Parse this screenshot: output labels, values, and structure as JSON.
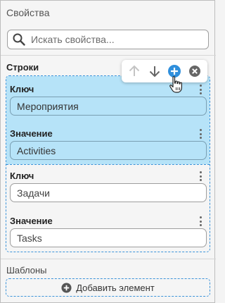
{
  "panel": {
    "title": "Свойства"
  },
  "search": {
    "placeholder": "Искать свойства..."
  },
  "rows_section": {
    "title": "Строки",
    "items": [
      {
        "key_label": "Ключ",
        "key_value": "Мероприятия",
        "value_label": "Значение",
        "value_value": "Activities",
        "selected": true
      },
      {
        "key_label": "Ключ",
        "key_value": "Задачи",
        "value_label": "Значение",
        "value_value": "Tasks",
        "selected": false
      }
    ]
  },
  "toolbar": {
    "icons": [
      "arrow-up-icon",
      "arrow-down-icon",
      "add-circle-icon",
      "close-circle-icon"
    ],
    "colors": {
      "disabled": "#c4c4c4",
      "active": "#666666",
      "accent": "#2f8fdc"
    }
  },
  "templates_section": {
    "title": "Шаблоны",
    "add_label": "Добавить элемент"
  },
  "colors": {
    "selection": "#b6e3f8",
    "dashed_border": "#3b93d9",
    "background": "#f5f5f5"
  }
}
